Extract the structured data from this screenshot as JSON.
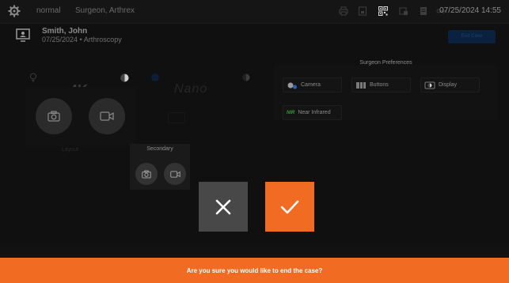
{
  "topbar": {
    "mode": "normal",
    "role": "Surgeon, Arthrex",
    "datetime": "07/25/2024 14:55"
  },
  "patient": {
    "name": "Smith, John",
    "details": "07/25/2024 • Arthroscopy"
  },
  "end_case_label": "End Case",
  "primary": {
    "resolution": "4K",
    "layout_label": "Layout"
  },
  "nano": {
    "label": "Nano"
  },
  "secondary": {
    "label": "Secondary"
  },
  "preferences": {
    "title": "Surgeon Preferences",
    "items": [
      "Camera",
      "Buttons",
      "Display",
      "Near Infrared"
    ],
    "nir_tag": "NIR"
  },
  "dialog": {
    "message": "Are you sure you would like to end the case?"
  },
  "colors": {
    "accent": "#f26b22",
    "cancel": "#484848"
  }
}
